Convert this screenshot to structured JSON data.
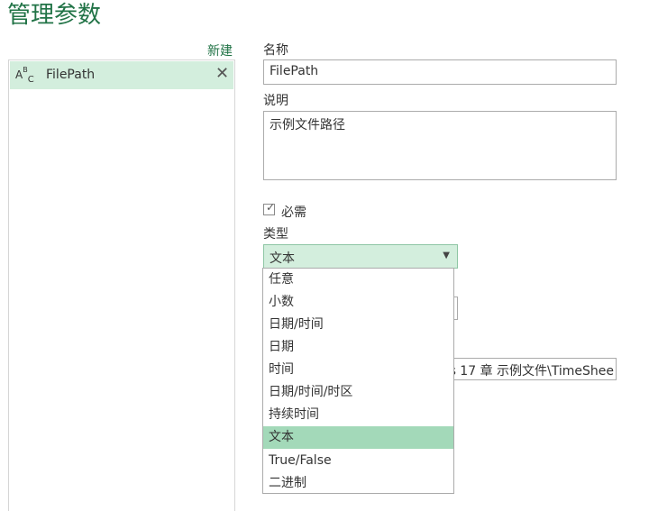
{
  "dialog": {
    "title": "管理参数",
    "new_label": "新建"
  },
  "parameters": [
    {
      "type_icon": "ABC",
      "name": "FilePath",
      "delete_icon": "close-icon"
    }
  ],
  "form": {
    "name_label": "名称",
    "name_value": "FilePath",
    "desc_label": "说明",
    "desc_value": "示例文件路径",
    "required_label": "必需",
    "required_checked": true,
    "type_label": "类型",
    "type_value": "文本",
    "current_value_partial": "s 17 章 示例文件\\TimeShee"
  },
  "type_options": [
    {
      "label": "任意"
    },
    {
      "label": "小数"
    },
    {
      "label": "日期/时间"
    },
    {
      "label": "日期"
    },
    {
      "label": "时间"
    },
    {
      "label": "日期/时间/时区"
    },
    {
      "label": "持续时间"
    },
    {
      "label": "文本",
      "selected": true
    },
    {
      "label": "True/False"
    },
    {
      "label": "二进制"
    }
  ],
  "colors": {
    "accent": "#217346",
    "selection": "#d3eedd",
    "option_selected": "#a3d9b9"
  }
}
